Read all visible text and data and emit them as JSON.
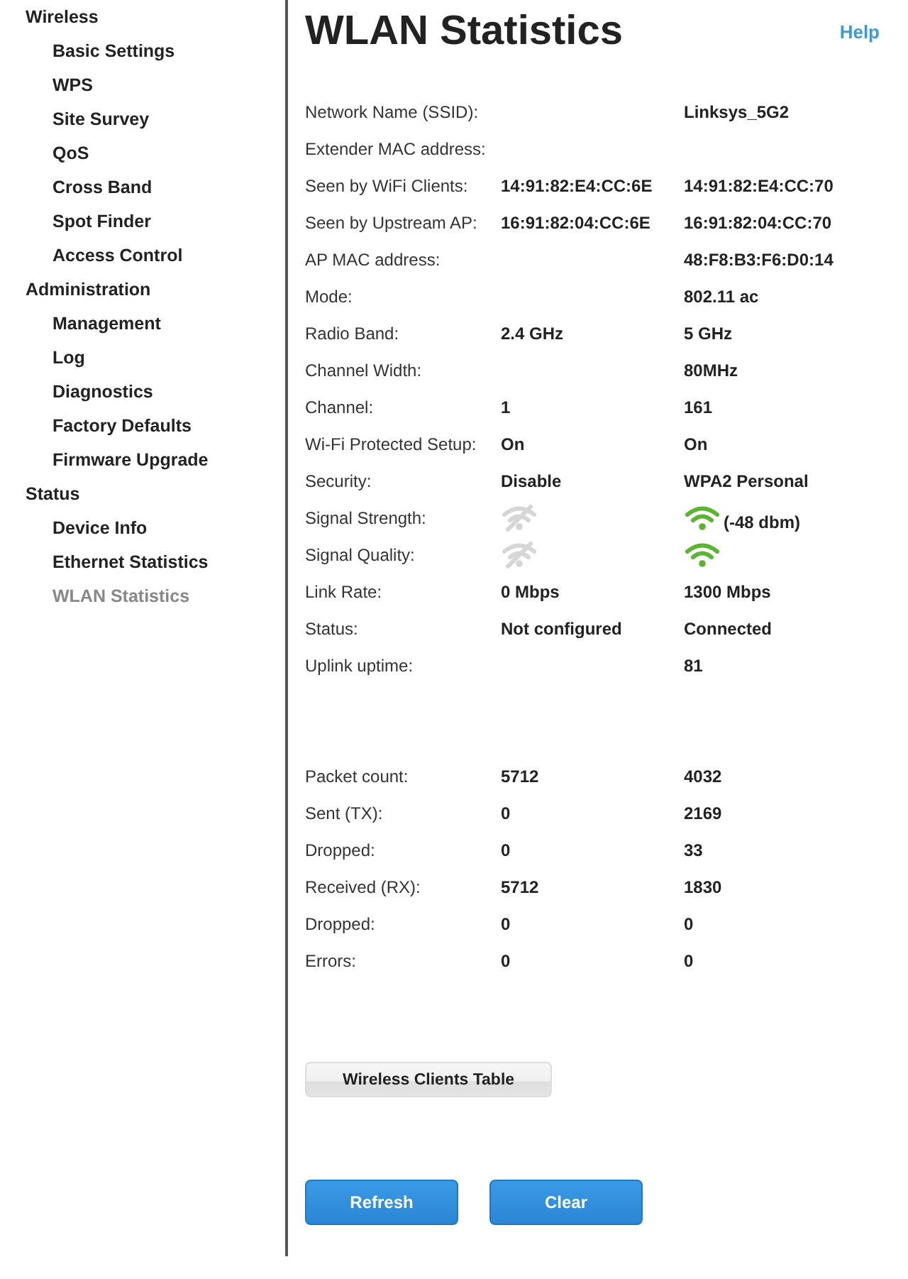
{
  "sidebar": {
    "sections": [
      {
        "label": "Wireless",
        "children": [
          {
            "label": "Basic Settings",
            "selected": false
          },
          {
            "label": "WPS",
            "selected": false
          },
          {
            "label": "Site Survey",
            "selected": false
          },
          {
            "label": "QoS",
            "selected": false
          },
          {
            "label": "Cross Band",
            "selected": false
          },
          {
            "label": "Spot Finder",
            "selected": false
          },
          {
            "label": "Access Control",
            "selected": false
          }
        ]
      },
      {
        "label": "Administration",
        "children": [
          {
            "label": "Management",
            "selected": false
          },
          {
            "label": "Log",
            "selected": false
          },
          {
            "label": "Diagnostics",
            "selected": false
          },
          {
            "label": "Factory Defaults",
            "selected": false
          },
          {
            "label": "Firmware Upgrade",
            "selected": false
          }
        ]
      },
      {
        "label": "Status",
        "children": [
          {
            "label": "Device Info",
            "selected": false
          },
          {
            "label": "Ethernet Statistics",
            "selected": false
          },
          {
            "label": "WLAN Statistics",
            "selected": true
          }
        ]
      }
    ]
  },
  "page": {
    "title": "WLAN Statistics",
    "help_link": "Help"
  },
  "info_rows": [
    {
      "label": "Network Name (SSID):",
      "column_2": {
        "kind": "text",
        "text": "Linksys_5G2"
      }
    },
    {
      "label": "Extender MAC address:"
    },
    {
      "label": "Seen by WiFi Clients:",
      "column_1": {
        "kind": "text",
        "text": "14:91:82:E4:CC:6E"
      },
      "column_2": {
        "kind": "text",
        "text": "14:91:82:E4:CC:70"
      }
    },
    {
      "label": "Seen by Upstream AP:",
      "column_1": {
        "kind": "text",
        "text": "16:91:82:04:CC:6E"
      },
      "column_2": {
        "kind": "text",
        "text": "16:91:82:04:CC:70"
      }
    },
    {
      "label": "AP MAC address:",
      "column_2": {
        "kind": "text",
        "text": "48:F8:B3:F6:D0:14"
      }
    },
    {
      "label": "Mode:",
      "column_2": {
        "kind": "text",
        "text": "802.11 ac"
      }
    },
    {
      "label": "Radio Band:",
      "column_1": {
        "kind": "text",
        "text": "2.4 GHz"
      },
      "column_2": {
        "kind": "text",
        "text": "5 GHz"
      }
    },
    {
      "label": "Channel Width:",
      "column_2": {
        "kind": "text",
        "text": "80MHz"
      }
    },
    {
      "label": "Channel:",
      "column_1": {
        "kind": "text",
        "text": "1"
      },
      "column_2": {
        "kind": "text",
        "text": "161"
      }
    },
    {
      "label": "Wi-Fi Protected Setup:",
      "column_1": {
        "kind": "text",
        "text": "On"
      },
      "column_2": {
        "kind": "text",
        "text": "On"
      }
    },
    {
      "label": "Security:",
      "column_1": {
        "kind": "text",
        "text": "Disable"
      },
      "column_2": {
        "kind": "text",
        "text": "WPA2 Personal"
      }
    },
    {
      "label": "Signal Strength:",
      "column_1": {
        "kind": "signal",
        "on": false
      },
      "column_2": {
        "kind": "signal",
        "on": true,
        "reading": "(-48 dbm)"
      }
    },
    {
      "label": "Signal Quality:",
      "column_1": {
        "kind": "signal",
        "on": false
      },
      "column_2": {
        "kind": "signal",
        "on": true
      }
    },
    {
      "label": "Link Rate:",
      "column_1": {
        "kind": "text",
        "text": "0 Mbps"
      },
      "column_2": {
        "kind": "text",
        "text": "1300 Mbps"
      }
    },
    {
      "label": "Status:",
      "column_1": {
        "kind": "text",
        "text": "Not configured"
      },
      "column_2": {
        "kind": "text",
        "text": "Connected"
      }
    },
    {
      "label": "Uplink uptime:",
      "column_2": {
        "kind": "text",
        "text": "81"
      }
    }
  ],
  "packet_rows": [
    {
      "label": "Packet count:",
      "column_1": {
        "kind": "text",
        "text": "5712"
      },
      "column_2": {
        "kind": "text",
        "text": "4032"
      }
    },
    {
      "label": "Sent (TX):",
      "column_1": {
        "kind": "text",
        "text": "0"
      },
      "column_2": {
        "kind": "text",
        "text": "2169"
      }
    },
    {
      "label": "Dropped:",
      "column_1": {
        "kind": "text",
        "text": "0"
      },
      "column_2": {
        "kind": "text",
        "text": "33"
      }
    },
    {
      "label": "Received (RX):",
      "column_1": {
        "kind": "text",
        "text": "5712"
      },
      "column_2": {
        "kind": "text",
        "text": "1830"
      }
    },
    {
      "label": "Dropped:",
      "column_1": {
        "kind": "text",
        "text": "0"
      },
      "column_2": {
        "kind": "text",
        "text": "0"
      }
    },
    {
      "label": "Errors:",
      "column_1": {
        "kind": "text",
        "text": "0"
      },
      "column_2": {
        "kind": "text",
        "text": "0"
      }
    }
  ],
  "clients_button": "Wireless Clients Table",
  "action_buttons": [
    "Refresh",
    "Clear"
  ]
}
